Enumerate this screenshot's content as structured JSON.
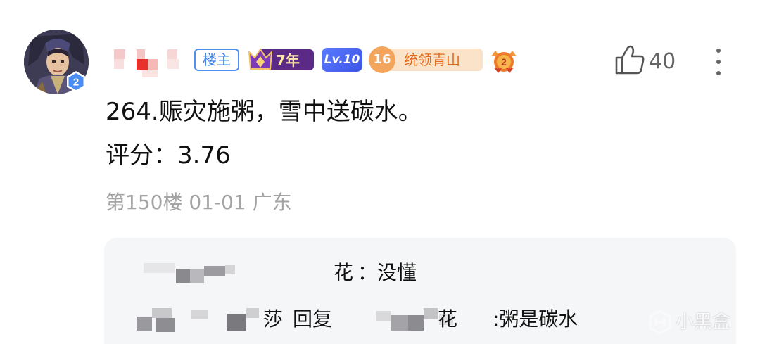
{
  "post": {
    "badges": {
      "host": "楼主",
      "years": "7年",
      "level": "Lv.10",
      "fan_level": "16",
      "fan_title": "统领青山",
      "avatar_level": "2",
      "medal_number": "2"
    },
    "likes": "40",
    "content": [
      "264.赈灾施粥，雪中送碳水。",
      "评分：3.76"
    ],
    "meta": "第150楼 01-01 广东"
  },
  "replies": [
    {
      "name_suffix": "花",
      "text": "：没懂"
    },
    {
      "name_suffix": "莎",
      "reply_word": "回复",
      "target_suffix": "花",
      "text": ":粥是碳水"
    }
  ],
  "watermark": "小黑盒",
  "icons": {
    "like": "thumbs-up-icon",
    "more": "more-vertical-icon",
    "crown": "crown-icon",
    "medal": "medal-icon",
    "watermark_logo": "xiaoheihe-logo-icon"
  },
  "colors": {
    "host_badge": "#3c7fe8",
    "level_badge": "#4a66f2",
    "fan_badge": "#e06a1c",
    "meta_text": "#a3a3a3",
    "reply_bg": "#f5f6f8"
  }
}
